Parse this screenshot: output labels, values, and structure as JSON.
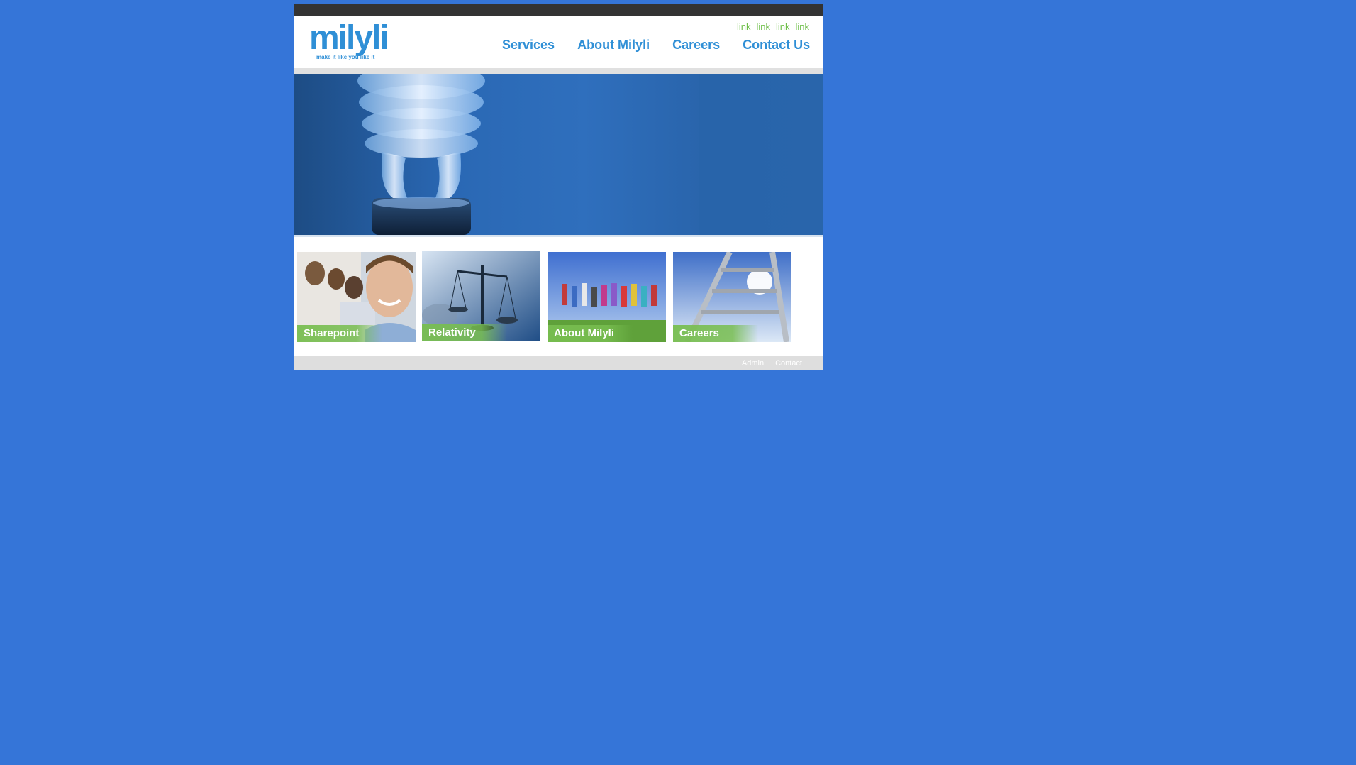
{
  "brand": {
    "name": "milyli",
    "tagline": "make it like you like it",
    "color": "#2f8fd6",
    "accent_color": "#6fbf4a"
  },
  "util_links": [
    "link",
    "link",
    "link",
    "link"
  ],
  "nav": {
    "items": [
      "Services",
      "About Milyli",
      "Careers",
      "Contact Us"
    ]
  },
  "tiles": [
    {
      "label": "Sharepoint",
      "image": "smiling-man-photo"
    },
    {
      "label": "Relativity",
      "image": "balance-scale-photo"
    },
    {
      "label": "About Milyli",
      "image": "jumping-people-photo"
    },
    {
      "label": "Careers",
      "image": "ladder-sky-photo"
    }
  ],
  "hero": {
    "image": "lightbulb-photo"
  },
  "footer": {
    "links": [
      "Admin",
      "Contact"
    ]
  },
  "colors": {
    "background": "#3575d8",
    "topbar": "#333333",
    "strip": "#e0e0e0"
  }
}
